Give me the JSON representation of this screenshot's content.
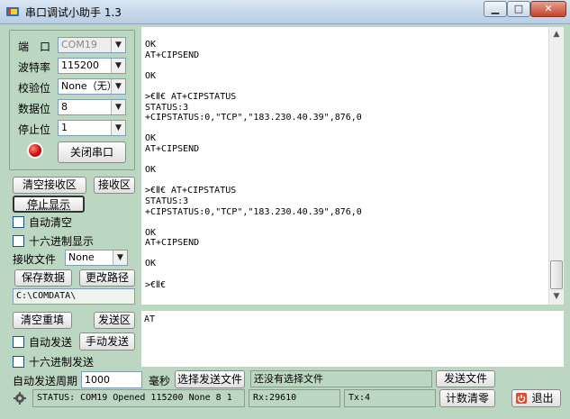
{
  "window": {
    "title": "串口调试小助手 1.3"
  },
  "port": {
    "port_label": "端　口",
    "port_value": "COM19",
    "baud_label": "波特率",
    "baud_value": "115200",
    "parity_label": "校验位",
    "parity_value": "None（无）",
    "databits_label": "数据位",
    "databits_value": "8",
    "stopbits_label": "停止位",
    "stopbits_value": "1",
    "close_port_label": "关闭串口"
  },
  "receive": {
    "clear_label": "清空接收区",
    "area_label": "接收区",
    "stop_display_label": "停止显示",
    "auto_clear_label": "自动清空",
    "hex_display_label": "十六进制显示",
    "file_label": "接收文件",
    "file_value": "None",
    "save_label": "保存数据",
    "change_path_label": "更改路径",
    "path_value": "C:\\COMDATA\\",
    "lines": [
      "OK",
      "AT+CIPSEND",
      "",
      "OK",
      "",
      ">€Ⅱ€ AT+CIPSTATUS",
      "STATUS:3",
      "+CIPSTATUS:0,\"TCP\",\"183.230.40.39\",876,0",
      "",
      "OK",
      "AT+CIPSEND",
      "",
      "OK",
      "",
      ">€Ⅱ€ AT+CIPSTATUS",
      "STATUS:3",
      "+CIPSTATUS:0,\"TCP\",\"183.230.40.39\",876,0",
      "",
      "OK",
      "AT+CIPSEND",
      "",
      "OK",
      "",
      ">€Ⅱ€"
    ]
  },
  "send": {
    "clear_label": "清空重填",
    "area_label": "发送区",
    "auto_send_label": "自动发送",
    "manual_send_label": "手动发送",
    "hex_send_label": "十六进制发送",
    "content": "AT",
    "period_label": "自动发送周期",
    "period_value": "1000",
    "ms_label": "毫秒",
    "choose_file_label": "选择发送文件",
    "file_status": "还没有选择文件",
    "send_file_label": "发送文件"
  },
  "status": {
    "status_text": "STATUS: COM19 Opened 115200 None  8 1",
    "rx": "Rx:29610",
    "tx": "Tx:4",
    "reset_count_label": "计数清零",
    "exit_label": "退出"
  },
  "colors": {
    "panel_bg": "#bcd7c1",
    "led": "#d40000",
    "close_button": "#c3442c"
  }
}
